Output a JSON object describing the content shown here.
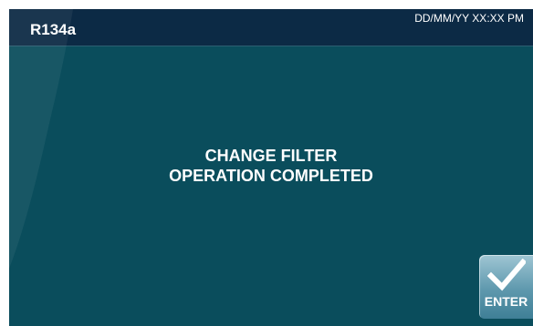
{
  "header": {
    "refrigerant": "R134a",
    "datetime": "DD/MM/YY XX:XX PM"
  },
  "message": {
    "line1": "CHANGE FILTER",
    "line2": "OPERATION COMPLETED"
  },
  "enter_button": {
    "label": "ENTER",
    "icon": "checkmark-icon"
  },
  "colors": {
    "screen_background": "#0a4d5c",
    "header_background": "#0c2a45",
    "text": "#ffffff",
    "button_top": "#9fc6d4",
    "button_bottom": "#3f7f96"
  }
}
